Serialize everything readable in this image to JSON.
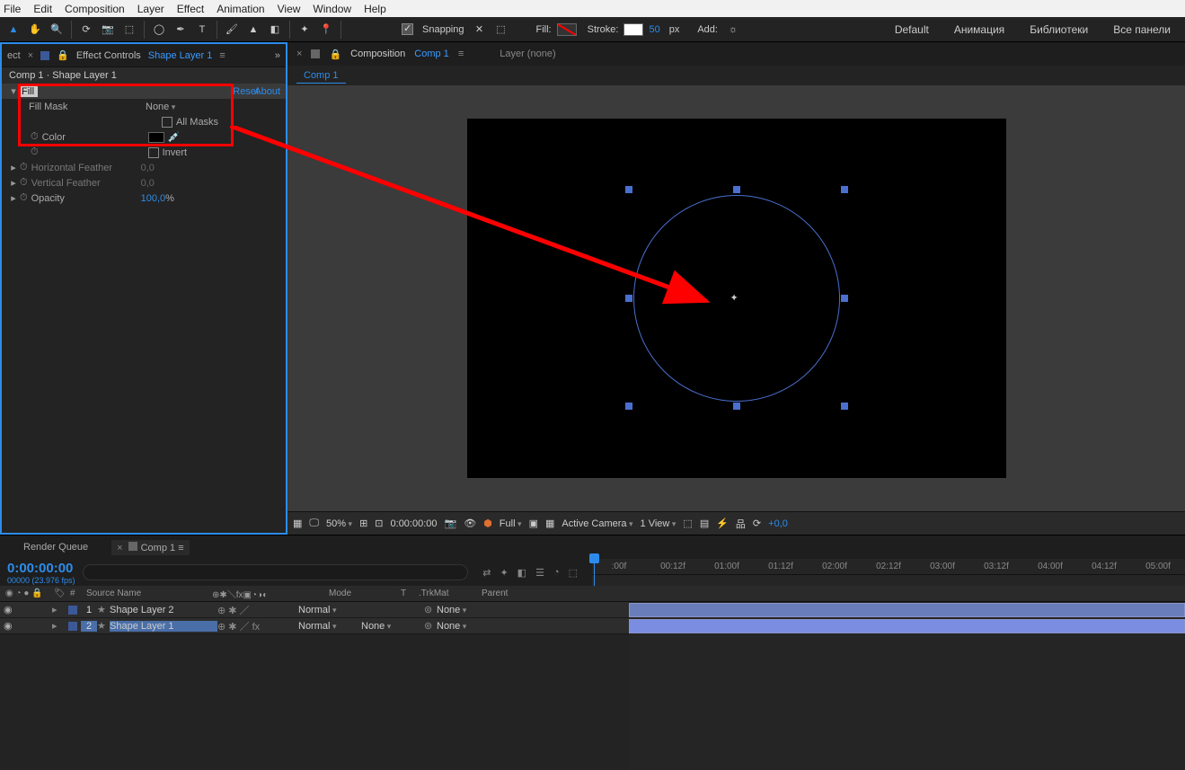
{
  "menu_bar": [
    "File",
    "Edit",
    "Composition",
    "Layer",
    "Effect",
    "Animation",
    "View",
    "Window",
    "Help"
  ],
  "toolbar": {
    "snapping": "Snapping",
    "fill_label": "Fill:",
    "stroke_label": "Stroke:",
    "stroke_width": "50",
    "stroke_unit": "px",
    "add_label": "Add:"
  },
  "workspaces": {
    "default": "Default",
    "w1": "Анимация",
    "w2": "Библиотеки",
    "w3": "Все панели"
  },
  "effect_panel": {
    "tab_prefix": "ect",
    "title": "Effect Controls",
    "layer": "Shape Layer 1",
    "crumb": "Comp 1 · Shape Layer 1",
    "fx_name": "Fill",
    "reset": "Reset",
    "about": "About",
    "fill_mask": "Fill Mask",
    "fill_mask_val": "None",
    "all_masks": "All Masks",
    "color": "Color",
    "invert": "Invert",
    "h_feather": "Horizontal Feather",
    "h_feather_val": "0,0",
    "v_feather": "Vertical Feather",
    "v_feather_val": "0,0",
    "opacity": "Opacity",
    "opacity_val": "100,0",
    "opacity_unit": "%"
  },
  "comp_panel": {
    "composition_label": "Composition",
    "comp_name": "Comp 1",
    "layer_none": "Layer (none)",
    "crumb": "Comp 1"
  },
  "view_controls": {
    "zoom": "50%",
    "timecode": "0:00:00:00",
    "resolution": "Full",
    "camera": "Active Camera",
    "views": "1 View",
    "exposure": "+0,0"
  },
  "timeline": {
    "render_queue": "Render Queue",
    "comp_tab": "Comp 1",
    "timecode": "0:00:00:00",
    "frame_info": "00000 (23.976 fps)",
    "col_num": "#",
    "col_source": "Source Name",
    "col_mode": "Mode",
    "col_t": "T",
    "col_trkmat": ".TrkMat",
    "col_parent": "Parent",
    "ruler": [
      ":00f",
      "00:12f",
      "01:00f",
      "01:12f",
      "02:00f",
      "02:12f",
      "03:00f",
      "03:12f",
      "04:00f",
      "04:12f",
      "05:00f"
    ],
    "layers": [
      {
        "num": "1",
        "name": "Shape Layer 2",
        "mode": "Normal",
        "trk": "",
        "parent": "None",
        "selected": false
      },
      {
        "num": "2",
        "name": "Shape Layer 1",
        "mode": "Normal",
        "trk": "None",
        "parent": "None",
        "selected": true
      }
    ]
  }
}
